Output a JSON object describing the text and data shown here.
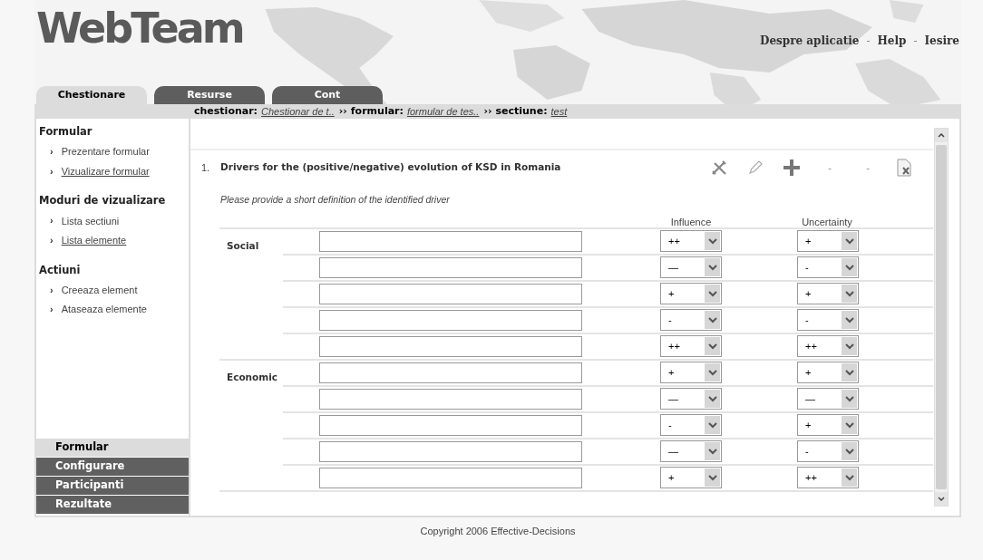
{
  "logo": "WebTeam",
  "top_links": [
    {
      "label": "Despre aplicatie"
    },
    {
      "label": "-",
      "kind": "separator"
    },
    {
      "label": "Help"
    },
    {
      "label": "-",
      "kind": "separator"
    },
    {
      "label": "Iesire"
    }
  ],
  "tabs": [
    {
      "label": "Chestionare",
      "selected": true
    },
    {
      "label": "Resurse",
      "selected": false
    },
    {
      "label": "Cont",
      "selected": false
    }
  ],
  "breadcrumb": [
    {
      "label": "chestionar:",
      "value": "Chestionar de t.."
    },
    {
      "separator": "››",
      "label": "formular:",
      "value": "formular de tes.."
    },
    {
      "separator": "››",
      "label": "sectiune:",
      "value": "test"
    }
  ],
  "sidebar": {
    "sections": [
      {
        "title": "Formular",
        "items": [
          {
            "marker": "›",
            "label": "Prezentare formular",
            "selected": false
          },
          {
            "marker": "›",
            "label": "Vizualizare formular",
            "selected": true
          }
        ]
      },
      {
        "title": "Moduri de vizualizare",
        "items": [
          {
            "marker": "›",
            "label": "Lista sectiuni",
            "selected": false
          },
          {
            "marker": "›",
            "label": "Lista elemente",
            "selected": true
          }
        ]
      },
      {
        "title": "Actiuni",
        "items": [
          {
            "marker": "›",
            "label": "Creeaza element",
            "selected": false
          },
          {
            "marker": "›",
            "label": "Ataseaza elemente",
            "selected": false
          }
        ]
      }
    ],
    "nav": [
      {
        "label": "Formular",
        "selected": true
      },
      {
        "label": "Configurare",
        "selected": false
      },
      {
        "label": "Participanti",
        "selected": false
      },
      {
        "label": "Rezultate",
        "selected": false
      }
    ]
  },
  "question": {
    "number": "1.",
    "title": "Drivers for the (positive/negative) evolution of KSD in Romania",
    "toolbar": [
      {
        "kind": "tools"
      },
      {
        "kind": "pencil"
      },
      {
        "kind": "plus"
      },
      {
        "kind": "text",
        "text": "-"
      },
      {
        "kind": "text",
        "text": "-"
      },
      {
        "kind": "delete"
      }
    ],
    "instruction": "Please provide a short definition of the identified driver",
    "columns": [
      "Influence",
      "Uncertainty"
    ],
    "groups": [
      {
        "name": "Social",
        "rows": [
          {
            "influence": "++",
            "uncertainty": "+"
          },
          {
            "influence": "—",
            "uncertainty": "-"
          },
          {
            "influence": "+",
            "uncertainty": "+"
          },
          {
            "influence": "-",
            "uncertainty": "-"
          },
          {
            "influence": "++",
            "uncertainty": "++"
          }
        ]
      },
      {
        "name": "Economic",
        "rows": [
          {
            "influence": "+",
            "uncertainty": "+"
          },
          {
            "influence": "—",
            "uncertainty": "—"
          },
          {
            "influence": "-",
            "uncertainty": "+"
          },
          {
            "influence": "—",
            "uncertainty": "-"
          },
          {
            "influence": "+",
            "uncertainty": "++"
          }
        ]
      }
    ]
  },
  "footer": "Copyright 2006 Effective-Decisions"
}
